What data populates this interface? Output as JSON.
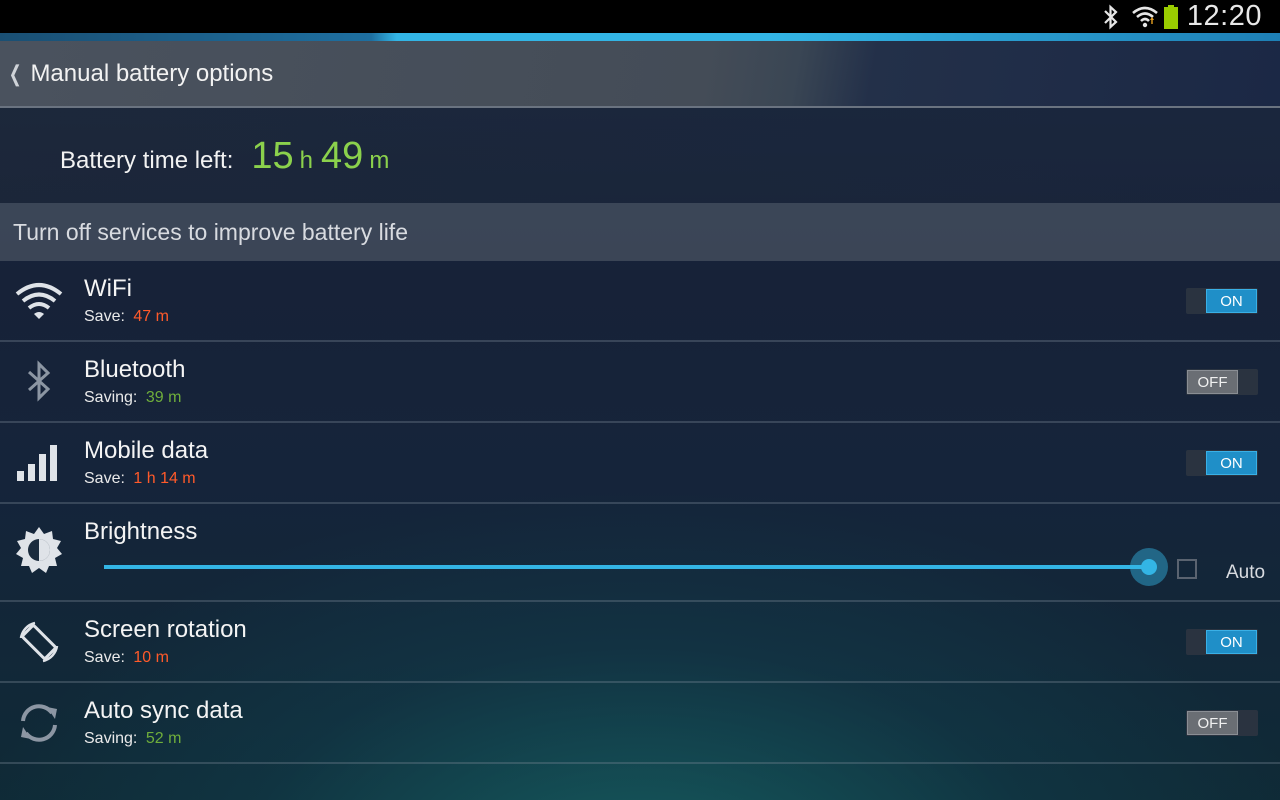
{
  "status_bar": {
    "clock": "12:20",
    "icons": [
      "bluetooth-icon",
      "wifi-icon",
      "battery-icon"
    ],
    "battery_color": "#99cc00"
  },
  "action_bar": {
    "title": "Manual battery options"
  },
  "battery": {
    "label": "Battery time left:",
    "hours": "15",
    "hours_unit": "h",
    "minutes": "49",
    "minutes_unit": "m",
    "value_color": "#8bd14c"
  },
  "section": {
    "header": "Turn off services to improve battery life"
  },
  "items": [
    {
      "title": "WiFi",
      "sub_label": "Save:",
      "sub_value": "47 m",
      "sub_color": "red",
      "toggle": "ON",
      "icon": "wifi-icon"
    },
    {
      "title": "Bluetooth",
      "sub_label": "Saving:",
      "sub_value": "39 m",
      "sub_color": "green",
      "toggle": "OFF",
      "icon": "bluetooth-icon"
    },
    {
      "title": "Mobile data",
      "sub_label": "Save:",
      "sub_value": "1 h 14 m",
      "sub_color": "red",
      "toggle": "ON",
      "icon": "signal-bars-icon"
    },
    {
      "title": "Screen rotation",
      "sub_label": "Save:",
      "sub_value": "10 m",
      "sub_color": "red",
      "toggle": "ON",
      "icon": "screen-rotation-icon"
    },
    {
      "title": "Auto sync data",
      "sub_label": "Saving:",
      "sub_value": "52 m",
      "sub_color": "green",
      "toggle": "OFF",
      "icon": "sync-icon"
    }
  ],
  "brightness": {
    "title": "Brightness",
    "level": 1.0,
    "auto_label": "Auto",
    "auto_checked": false,
    "icon": "brightness-icon"
  },
  "colors": {
    "accent": "#33b5e5",
    "save_red": "#ff5a2a",
    "saving_green": "#6fae3b",
    "toggle_on": "#1f8fc8",
    "toggle_off": "#6a6e74"
  }
}
